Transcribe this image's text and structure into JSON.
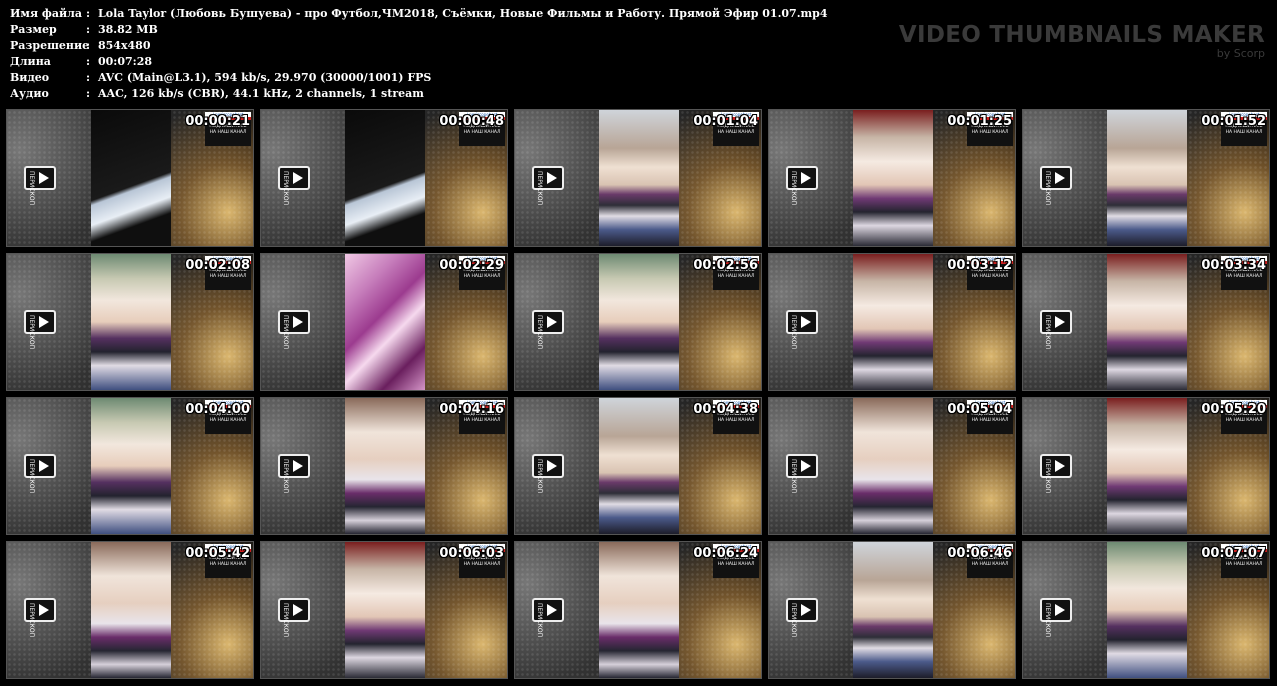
{
  "file_info": [
    {
      "label": "Имя файла",
      "value": "Lola Taylor (Любовь Бушуева) - про Футбол,ЧМ2018, Съёмки, Новые Фильмы и Работу. Прямой Эфир 01.07.mp4"
    },
    {
      "label": "Размер",
      "value": "38.82 MB"
    },
    {
      "label": "Разрешение",
      "value": "854x480"
    },
    {
      "label": "Длина",
      "value": "00:07:28"
    },
    {
      "label": "Видео",
      "value": "AVC (Main@L3.1), 594 kb/s, 29.970 (30000/1001) FPS"
    },
    {
      "label": "Аудио",
      "value": "AAC, 126 kb/s (CBR), 44.1 kHz, 2 channels, 1 stream"
    }
  ],
  "separator": ":",
  "brand": {
    "title": "VIDEO THUMBNAILS MAKER",
    "subtitle": "by Scorp"
  },
  "badge": {
    "top": "/ periscopebest",
    "line1": "ПОДПИШИТЕСЬ",
    "line2": "НА НАШ КАНАЛ"
  },
  "logo": {
    "text": "ПЕРИСКОП"
  },
  "thumbnails": [
    {
      "time": "00:00:21",
      "scene": "dark"
    },
    {
      "time": "00:00:48",
      "scene": "dark"
    },
    {
      "time": "00:01:04",
      "scene": "person"
    },
    {
      "time": "00:01:25",
      "scene": "car"
    },
    {
      "time": "00:01:52",
      "scene": "person"
    },
    {
      "time": "00:02:08",
      "scene": "person3"
    },
    {
      "time": "00:02:29",
      "scene": "soccer"
    },
    {
      "time": "00:02:56",
      "scene": "person3"
    },
    {
      "time": "00:03:12",
      "scene": "car"
    },
    {
      "time": "00:03:34",
      "scene": "car"
    },
    {
      "time": "00:04:00",
      "scene": "person3"
    },
    {
      "time": "00:04:16",
      "scene": "person2"
    },
    {
      "time": "00:04:38",
      "scene": "person"
    },
    {
      "time": "00:05:04",
      "scene": "person2"
    },
    {
      "time": "00:05:20",
      "scene": "car"
    },
    {
      "time": "00:05:42",
      "scene": "person2"
    },
    {
      "time": "00:06:03",
      "scene": "car"
    },
    {
      "time": "00:06:24",
      "scene": "person2"
    },
    {
      "time": "00:06:46",
      "scene": "person"
    },
    {
      "time": "00:07:07",
      "scene": "person3"
    }
  ]
}
